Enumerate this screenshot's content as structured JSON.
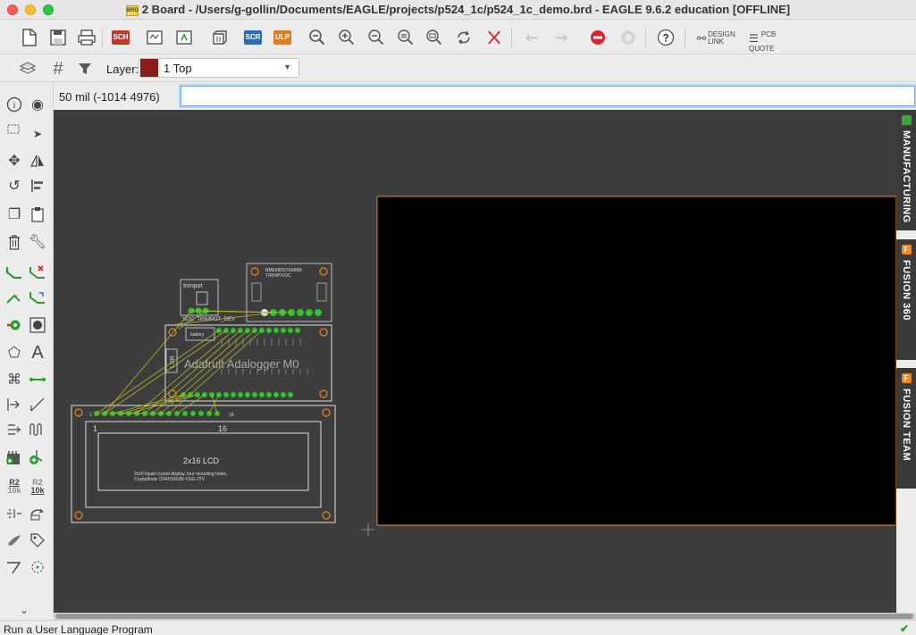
{
  "window": {
    "title": "2 Board - /Users/g-gollin/Documents/EAGLE/projects/p524_1c/p524_1c_demo.brd - EAGLE 9.6.2 education [OFFLINE]",
    "doc_icon_text": "BRD"
  },
  "toolbar": {
    "sch_badge": "SCH",
    "scr_badge": "SCR",
    "ulp_badge": "ULP",
    "design_link": [
      "DESIGN",
      "LINK"
    ],
    "pcb_quote": [
      "PCB",
      "QUOTE"
    ],
    "colors": {
      "sch": "#c0392b",
      "scr": "#2a6ebb",
      "ulp": "#e07b1f",
      "stop": "#e0202a"
    }
  },
  "toolbar2": {
    "layer_label": "Layer:",
    "layer_value": "1 Top",
    "layer_color": "#8b1a1a"
  },
  "command": {
    "coordinate": "50 mil (-1014 4976)",
    "input_value": ""
  },
  "board": {
    "trimpot_label": "trimpot",
    "trimpot_part": "SOC_TRIMPOT_DEV",
    "bme_label": "BME680STEMMA",
    "bme_sub": "T/RH/P/VOC",
    "mcu_label": "Adafruit Adalogger M0",
    "battery_label": "battery",
    "lcd_title": "2x16 LCD",
    "lcd_desc1": "2x16 liquid crystal display, four mounting holes.",
    "lcd_desc2": "Crystalfontz CFAH1602B-YGG-JTV",
    "lcd_pin1": "1",
    "lcd_pin16": "16",
    "lcd_pin16_small": "16",
    "lcd_pin1_small": "1",
    "lsr_label": "LSR",
    "outline_color": "#e08a1e",
    "pad_color": "#2fc12f",
    "airwire_color": "#b5b52a"
  },
  "side_panels": [
    {
      "label": "MANUFACTURING",
      "icon_color": "#3aa63a",
      "icon_text": ""
    },
    {
      "label": "FUSION 360",
      "icon_color": "#f08a1e",
      "icon_text": "F"
    },
    {
      "label": "FUSION TEAM",
      "icon_color": "#f08a1e",
      "icon_text": "F"
    }
  ],
  "status": {
    "message": "Run a User Language Program"
  },
  "palette": {
    "r2_label": "R2",
    "r2_value": "10k"
  }
}
